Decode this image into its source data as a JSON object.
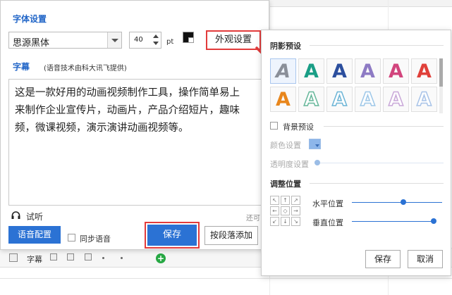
{
  "dialog": {
    "title": "字体设置",
    "font_family_value": "思源黑体",
    "font_size_value": "40",
    "font_size_unit": "pt",
    "appearance_button_label": "外观设置",
    "subtitle_label": "字幕",
    "subtitle_note": "(语音技术由科大讯飞提供)",
    "text_content": "这是一款好用的动画视频制作工具，操作简单易上\n来制作企业宣传片，动画片，产品介绍短片，趣味\n频，微课视频，演示演讲动画视频等。",
    "listen_label": "试听",
    "cut_label": "还可",
    "voice_config_button": "语音配置",
    "sync_voice_label": "同步语音",
    "save_button": "保存",
    "add_by_paragraph_button": "按段落添加"
  },
  "timeline": {
    "subtitle_label": "字幕"
  },
  "panel": {
    "shadow_preset_title": "阴影预设",
    "style_presets": [
      {
        "glyph": "A",
        "color": "#8a8f99"
      },
      {
        "glyph": "A",
        "color": "#1a9e86"
      },
      {
        "glyph": "A",
        "color": "#2c4f9e"
      },
      {
        "glyph": "A",
        "color": "#8e7bc4"
      },
      {
        "glyph": "A",
        "color": "#d2457d"
      },
      {
        "glyph": "A",
        "color": "#e0403a"
      },
      {
        "glyph": "A",
        "color": "#e8861c"
      },
      {
        "glyph": "A",
        "color": "#66b79a"
      },
      {
        "glyph": "A",
        "color": "#6bb4d6"
      },
      {
        "glyph": "A",
        "color": "#9ec7e8"
      },
      {
        "glyph": "A",
        "color": "#c9a8d8"
      },
      {
        "glyph": "A",
        "color": "#a8c3e8"
      }
    ],
    "background_preset_label": "背景预设",
    "bg_color_label": "颜色设置",
    "transparency_label": "透明度设置",
    "adjust_position_title": "调整位置",
    "horizontal_label": "水平位置",
    "vertical_label": "垂直位置",
    "horizontal_value": 0.57,
    "vertical_value": 1.0,
    "save_button": "保存",
    "cancel_button": "取消"
  },
  "colors": {
    "accent": "#2b72d4",
    "highlight": "#e23b3b",
    "title_blue": "#2367c8"
  }
}
